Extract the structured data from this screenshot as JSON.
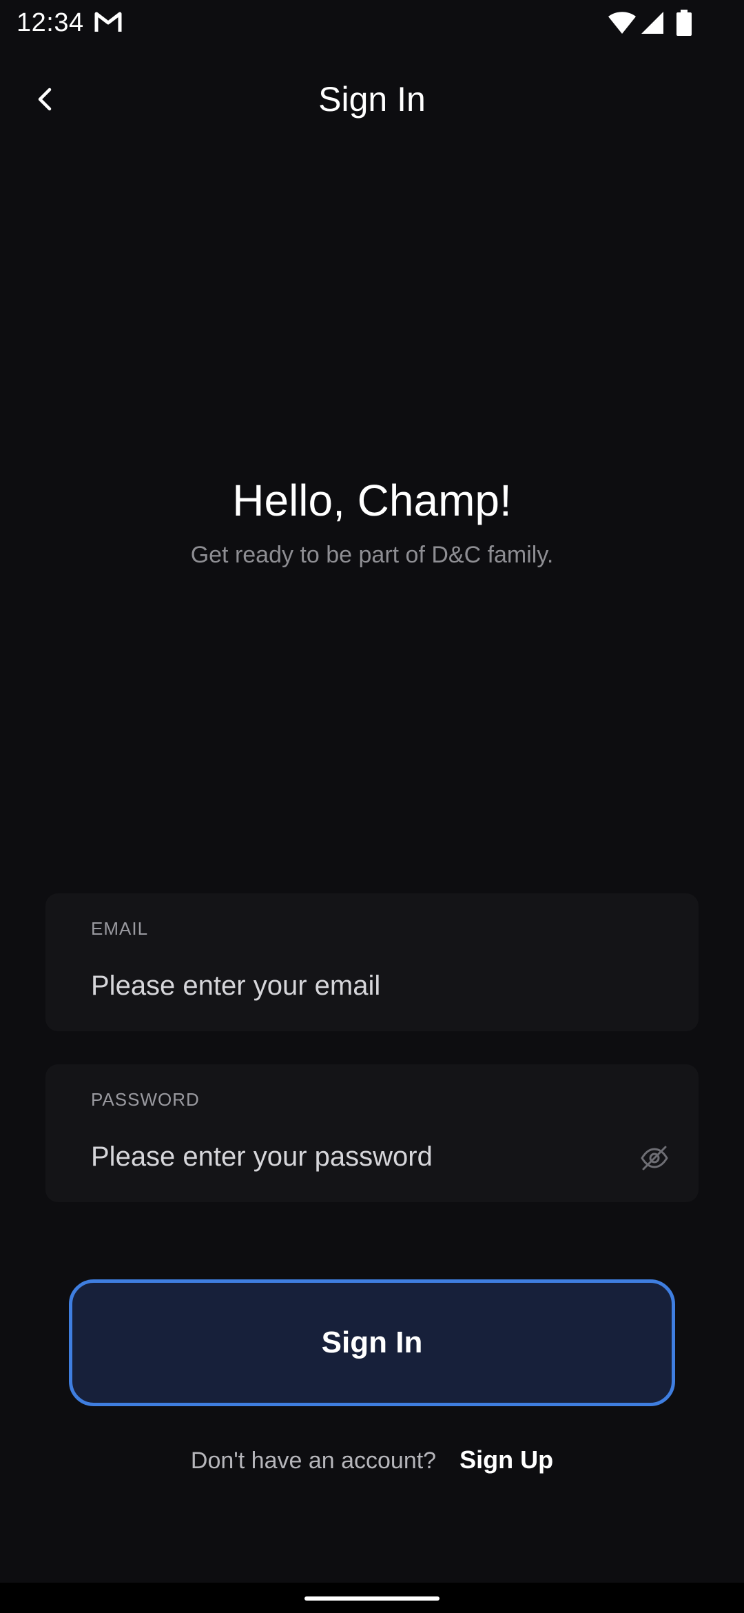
{
  "status_bar": {
    "time": "12:34",
    "icons": [
      "gmail-icon",
      "wifi-icon",
      "signal-icon",
      "battery-icon"
    ]
  },
  "app_bar": {
    "back_icon": "chevron-left-icon",
    "title": "Sign In"
  },
  "greeting": {
    "title": "Hello, Champ!",
    "subtitle": "Get ready to be part of D&C family."
  },
  "form": {
    "email": {
      "label": "EMAIL",
      "placeholder": "Please enter your email",
      "value": ""
    },
    "password": {
      "label": "PASSWORD",
      "placeholder": "Please enter your password",
      "value": "",
      "toggle_icon": "eye-off-icon"
    },
    "submit_label": "Sign In"
  },
  "footer": {
    "prompt": "Don't have an account?",
    "signup_label": "Sign Up"
  },
  "colors": {
    "background": "#0d0d10",
    "field_background": "#141417",
    "accent_border": "#3f7ee0",
    "button_fill": "#17203a",
    "muted_text": "#8e8e93"
  }
}
